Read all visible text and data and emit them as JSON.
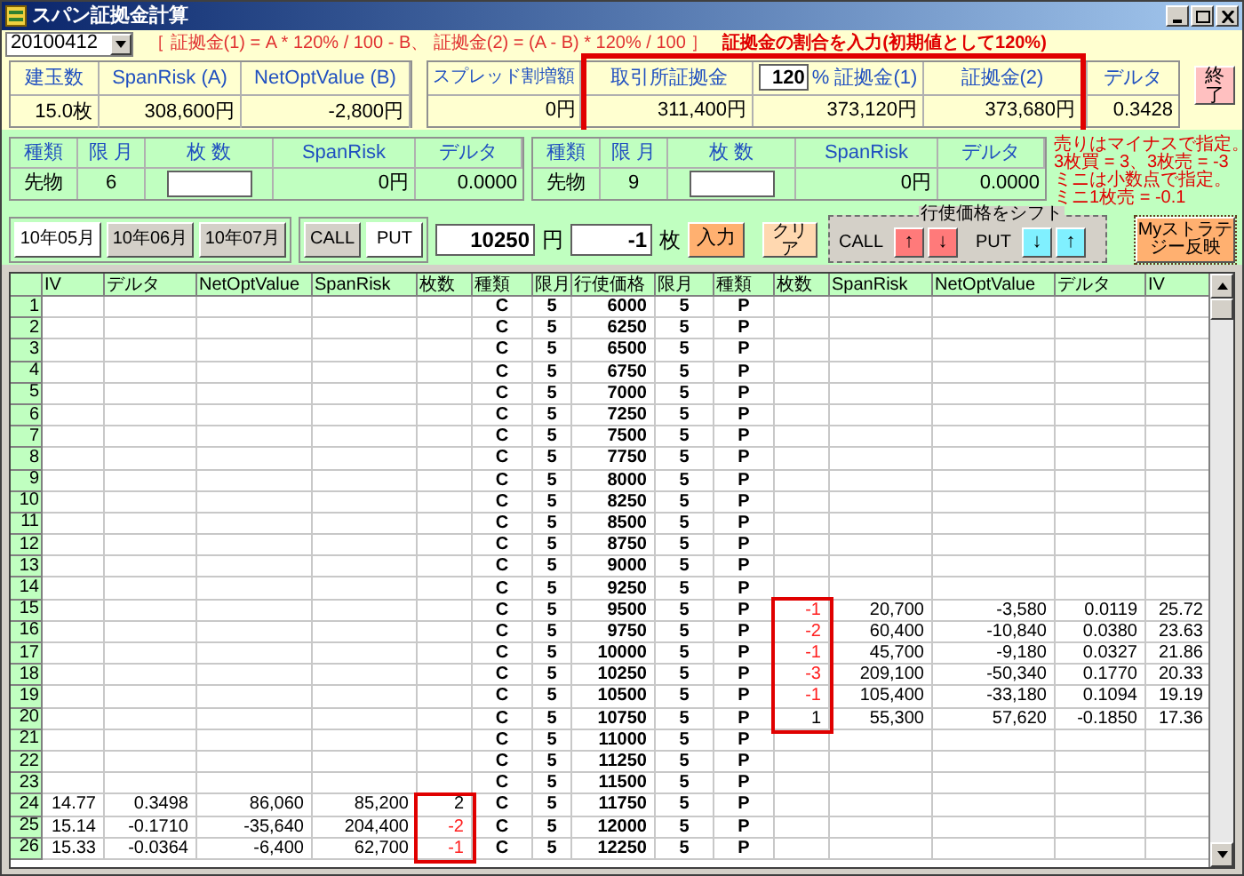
{
  "window": {
    "title": "スパン証拠金計算"
  },
  "date_select": {
    "value": "20100412"
  },
  "formula": "［ 証拠金(1) = A * 120% / 100 - B、 証拠金(2) = (A - B) * 120% / 100 ］",
  "rate_hint": "証拠金の割合を入力(初期値として120%)",
  "summary": {
    "headers": [
      "建玉数",
      "SpanRisk (A)",
      "NetOptValue (B)"
    ],
    "values": [
      "15.0枚",
      "308,600円",
      "-2,800円"
    ]
  },
  "margin": {
    "spread_label": "スプレッド割増額",
    "spread_value": "0円",
    "exchange_label": "取引所証拠金",
    "exchange_value": "311,400円",
    "rate": "120",
    "margin1_label": "% 証拠金(1)",
    "margin1_value": "373,120円",
    "margin2_label": "証拠金(2)",
    "margin2_value": "373,680円",
    "delta_label": "デルタ",
    "delta_value": "0.3428",
    "highlighted": true
  },
  "exit_button": "終了",
  "futures": [
    {
      "headers": [
        "種類",
        "限 月",
        "枚 数",
        "SpanRisk",
        "デルタ"
      ],
      "type": "先物",
      "month": "6",
      "span_risk": "0円",
      "delta": "0.0000"
    },
    {
      "headers": [
        "種類",
        "限 月",
        "枚 数",
        "SpanRisk",
        "デルタ"
      ],
      "type": "先物",
      "month": "9",
      "span_risk": "0円",
      "delta": "0.0000"
    }
  ],
  "note_lines": [
    "売りはマイナスで指定。",
    "3枚買 = 3、3枚売 = -3",
    "ミニは小数点で指定。",
    "ミニ1枚売 = -0.1"
  ],
  "months": [
    {
      "label": "10年05月",
      "selected": true
    },
    {
      "label": "10年06月",
      "selected": false
    },
    {
      "label": "10年07月",
      "selected": false
    }
  ],
  "option_types": [
    {
      "label": "CALL",
      "selected": false
    },
    {
      "label": "PUT",
      "selected": true
    }
  ],
  "strike": {
    "value": "10250",
    "unit": "円"
  },
  "quantity": {
    "value": "-1",
    "unit": "枚"
  },
  "enter_button": "入力",
  "clear_button": "クリア",
  "shift": {
    "legend": "行使価格をシフト",
    "groups": [
      {
        "label": "CALL",
        "kind": "call",
        "buttons": [
          "↑",
          "↓"
        ]
      },
      {
        "label": "PUT",
        "kind": "put",
        "buttons": [
          "↓",
          "↑"
        ]
      }
    ]
  },
  "strategy_button": "Myストラテジー反映",
  "table": {
    "columns": [
      "IV",
      "デルタ",
      "NetOptValue",
      "SpanRisk",
      "枚数",
      "種類",
      "限月",
      "行使価格",
      "限月",
      "種類",
      "枚数",
      "SpanRisk",
      "NetOptValue",
      "デルタ",
      "IV"
    ],
    "rows": [
      {
        "no": "1",
        "call_type": "C",
        "call_month": "5",
        "strike": "6000",
        "put_month": "5",
        "put_type": "P"
      },
      {
        "no": "2",
        "call_type": "C",
        "call_month": "5",
        "strike": "6250",
        "put_month": "5",
        "put_type": "P"
      },
      {
        "no": "3",
        "call_type": "C",
        "call_month": "5",
        "strike": "6500",
        "put_month": "5",
        "put_type": "P"
      },
      {
        "no": "4",
        "call_type": "C",
        "call_month": "5",
        "strike": "6750",
        "put_month": "5",
        "put_type": "P"
      },
      {
        "no": "5",
        "call_type": "C",
        "call_month": "5",
        "strike": "7000",
        "put_month": "5",
        "put_type": "P"
      },
      {
        "no": "6",
        "call_type": "C",
        "call_month": "5",
        "strike": "7250",
        "put_month": "5",
        "put_type": "P"
      },
      {
        "no": "7",
        "call_type": "C",
        "call_month": "5",
        "strike": "7500",
        "put_month": "5",
        "put_type": "P"
      },
      {
        "no": "8",
        "call_type": "C",
        "call_month": "5",
        "strike": "7750",
        "put_month": "5",
        "put_type": "P"
      },
      {
        "no": "9",
        "call_type": "C",
        "call_month": "5",
        "strike": "8000",
        "put_month": "5",
        "put_type": "P"
      },
      {
        "no": "10",
        "call_type": "C",
        "call_month": "5",
        "strike": "8250",
        "put_month": "5",
        "put_type": "P"
      },
      {
        "no": "11",
        "call_type": "C",
        "call_month": "5",
        "strike": "8500",
        "put_month": "5",
        "put_type": "P"
      },
      {
        "no": "12",
        "call_type": "C",
        "call_month": "5",
        "strike": "8750",
        "put_month": "5",
        "put_type": "P"
      },
      {
        "no": "13",
        "call_type": "C",
        "call_month": "5",
        "strike": "9000",
        "put_month": "5",
        "put_type": "P"
      },
      {
        "no": "14",
        "call_type": "C",
        "call_month": "5",
        "strike": "9250",
        "put_month": "5",
        "put_type": "P"
      },
      {
        "no": "15",
        "call_type": "C",
        "call_month": "5",
        "strike": "9500",
        "put_month": "5",
        "put_type": "P",
        "put": {
          "qty": "-1",
          "sell": true,
          "marked": true,
          "span_risk": "20,700",
          "net_opt_value": "-3,580",
          "delta": "0.0119",
          "iv": "25.72"
        }
      },
      {
        "no": "16",
        "call_type": "C",
        "call_month": "5",
        "strike": "9750",
        "put_month": "5",
        "put_type": "P",
        "put": {
          "qty": "-2",
          "sell": true,
          "marked": true,
          "span_risk": "60,400",
          "net_opt_value": "-10,840",
          "delta": "0.0380",
          "iv": "23.63"
        }
      },
      {
        "no": "17",
        "call_type": "C",
        "call_month": "5",
        "strike": "10000",
        "put_month": "5",
        "put_type": "P",
        "put": {
          "qty": "-1",
          "sell": true,
          "marked": true,
          "span_risk": "45,700",
          "net_opt_value": "-9,180",
          "delta": "0.0327",
          "iv": "21.86"
        }
      },
      {
        "no": "18",
        "call_type": "C",
        "call_month": "5",
        "strike": "10250",
        "put_month": "5",
        "put_type": "P",
        "put": {
          "qty": "-3",
          "sell": true,
          "marked": true,
          "span_risk": "209,100",
          "net_opt_value": "-50,340",
          "delta": "0.1770",
          "iv": "20.33"
        }
      },
      {
        "no": "19",
        "call_type": "C",
        "call_month": "5",
        "strike": "10500",
        "put_month": "5",
        "put_type": "P",
        "put": {
          "qty": "-1",
          "sell": true,
          "marked": true,
          "span_risk": "105,400",
          "net_opt_value": "-33,180",
          "delta": "0.1094",
          "iv": "19.19"
        }
      },
      {
        "no": "20",
        "call_type": "C",
        "call_month": "5",
        "strike": "10750",
        "put_month": "5",
        "put_type": "P",
        "put": {
          "qty": "1",
          "sell": false,
          "marked": true,
          "span_risk": "55,300",
          "net_opt_value": "57,620",
          "delta": "-0.1850",
          "iv": "17.36"
        }
      },
      {
        "no": "21",
        "call_type": "C",
        "call_month": "5",
        "strike": "11000",
        "put_month": "5",
        "put_type": "P"
      },
      {
        "no": "22",
        "call_type": "C",
        "call_month": "5",
        "strike": "11250",
        "put_month": "5",
        "put_type": "P"
      },
      {
        "no": "23",
        "call_type": "C",
        "call_month": "5",
        "strike": "11500",
        "put_month": "5",
        "put_type": "P"
      },
      {
        "no": "24",
        "call_type": "C",
        "call_month": "5",
        "strike": "11750",
        "put_month": "5",
        "put_type": "P",
        "call": {
          "iv": "14.77",
          "delta": "0.3498",
          "net_opt_value": "86,060",
          "span_risk": "85,200",
          "qty": "2",
          "sell": false,
          "marked": true
        }
      },
      {
        "no": "25",
        "call_type": "C",
        "call_month": "5",
        "strike": "12000",
        "put_month": "5",
        "put_type": "P",
        "call": {
          "iv": "15.14",
          "delta": "-0.1710",
          "net_opt_value": "-35,640",
          "span_risk": "204,400",
          "qty": "-2",
          "sell": true,
          "marked": true
        }
      },
      {
        "no": "26",
        "call_type": "C",
        "call_month": "5",
        "strike": "12250",
        "put_month": "5",
        "put_type": "P",
        "call": {
          "iv": "15.33",
          "delta": "-0.0364",
          "net_opt_value": "-6,400",
          "span_risk": "62,700",
          "qty": "-1",
          "sell": true,
          "marked": true
        }
      }
    ]
  }
}
